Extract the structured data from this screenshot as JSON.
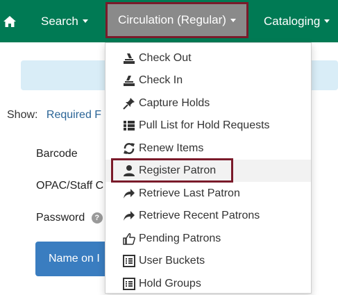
{
  "nav": {
    "search_label": "Search",
    "circulation_label": "Circulation (Regular)",
    "cataloging_label": "Cataloging"
  },
  "page": {
    "show_label": "Show:",
    "show_link": "Required F",
    "barcode_label": "Barcode",
    "opac_label": "OPAC/Staff C",
    "password_label": "Password",
    "help_glyph": "?",
    "name_button": "Name on I"
  },
  "dropdown": {
    "items": [
      {
        "label": "Check Out",
        "icon": "checkout-icon"
      },
      {
        "label": "Check In",
        "icon": "checkin-icon"
      },
      {
        "label": "Capture Holds",
        "icon": "pushpin-icon"
      },
      {
        "label": "Pull List for Hold Requests",
        "icon": "list-icon"
      },
      {
        "label": "Renew Items",
        "icon": "refresh-icon"
      },
      {
        "label": "Register Patron",
        "icon": "user-icon"
      },
      {
        "label": "Retrieve Last Patron",
        "icon": "share-arrow-icon"
      },
      {
        "label": "Retrieve Recent Patrons",
        "icon": "share-arrow-icon"
      },
      {
        "label": "Pending Patrons",
        "icon": "thumbs-up-icon"
      },
      {
        "label": "User Buckets",
        "icon": "list-alt-icon"
      },
      {
        "label": "Hold Groups",
        "icon": "list-alt-icon"
      }
    ]
  },
  "colors": {
    "navbar": "#007a54",
    "active_nav": "#8a8a8a",
    "highlight_border": "#7a1a2a",
    "alert_bg": "#d9edf7",
    "primary_button": "#3a7dc0"
  }
}
